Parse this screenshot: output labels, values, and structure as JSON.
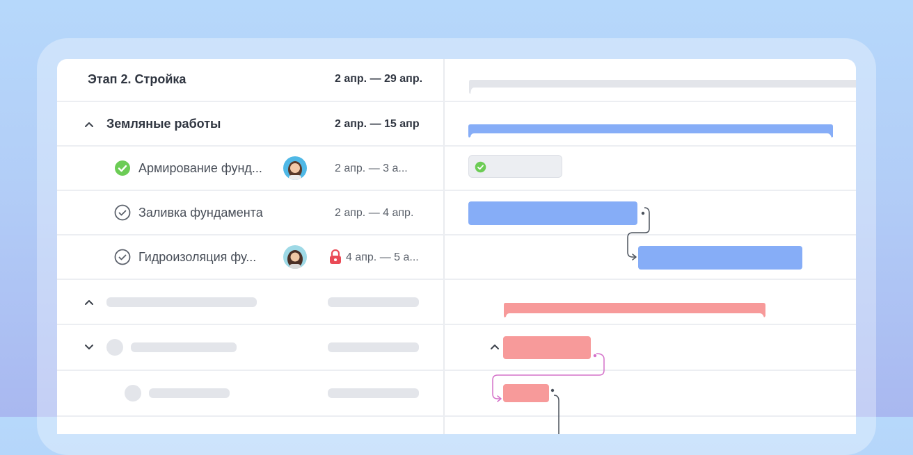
{
  "stage": {
    "title": "Этап 2. Стройка",
    "dates": "2 апр. — 29 апр."
  },
  "group": {
    "title": "Земляные работы",
    "dates": "2 апр. — 15 апр"
  },
  "tasks": [
    {
      "label": "Армирование фунд...",
      "dates": "2 апр. — 3 а...",
      "status": "completed",
      "icon": "check-filled-icon"
    },
    {
      "label": "Заливка фундамента",
      "dates": "2 апр. — 4 апр.",
      "status": "open",
      "icon": "check-outline-icon"
    },
    {
      "label": "Гидроизоляция фу...",
      "dates": "4 апр. — 5 а...",
      "status": "open",
      "icon": "check-outline-icon",
      "locked": true
    }
  ],
  "colors": {
    "accent_blue": "#86adf7",
    "accent_red": "#f79a9a",
    "success_green": "#6ccc55",
    "lock_red": "#ea4a56",
    "skeleton": "#e3e5ea"
  }
}
